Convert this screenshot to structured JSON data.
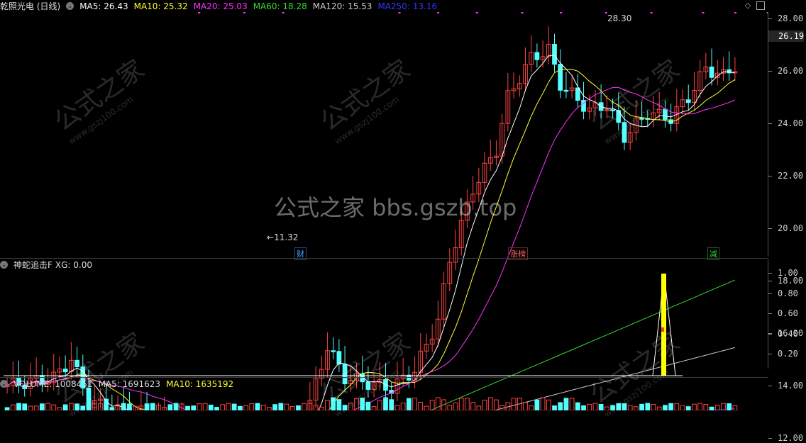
{
  "header": {
    "stock": "乾照光电 (日线)",
    "mas": [
      {
        "label": "MA5: 26.43",
        "color": "#ffffff"
      },
      {
        "label": "MA10: 25.32",
        "color": "#ffff33"
      },
      {
        "label": "MA20: 25.03",
        "color": "#ff33ff"
      },
      {
        "label": "MA60: 18.28",
        "color": "#33dd33"
      },
      {
        "label": "MA120: 15.53",
        "color": "#cccccc"
      },
      {
        "label": "MA250: 13.16",
        "color": "#3333ff"
      }
    ]
  },
  "price_axis": [
    "28.00",
    "26.00",
    "24.00",
    "22.00",
    "20.00",
    "18.00",
    "16.00",
    "14.00",
    "12.00"
  ],
  "current_price": "26.19",
  "high_label": "28.30",
  "low_label": "11.32",
  "events": [
    {
      "label": "财",
      "color": "#4aa3ff"
    },
    {
      "label": "涨榜",
      "color": "#ff5555"
    },
    {
      "label": "减",
      "color": "#33dd33"
    }
  ],
  "indicator": {
    "title": "神蛇追击F",
    "value": "XG: 0.00",
    "axis": [
      "1.00",
      "0.80",
      "0.60",
      "0.40",
      "0.20"
    ]
  },
  "volume": {
    "label": "VOLUME: 1008451",
    "ma5": "MA5: 1691623",
    "ma10": "MA10: 1635192"
  },
  "watermark": {
    "center": "公式之家 bbs.gszb.top",
    "tile": "公式之家",
    "tile_url": "www.gszj100.com"
  },
  "colors": {
    "up": "#ff4444",
    "down": "#54ffff",
    "ma5": "#ffffff",
    "ma10": "#ffff33",
    "ma20": "#ff33ff",
    "ma60": "#33dd33",
    "ma120": "#cccccc",
    "ma250": "#3333ff"
  }
}
